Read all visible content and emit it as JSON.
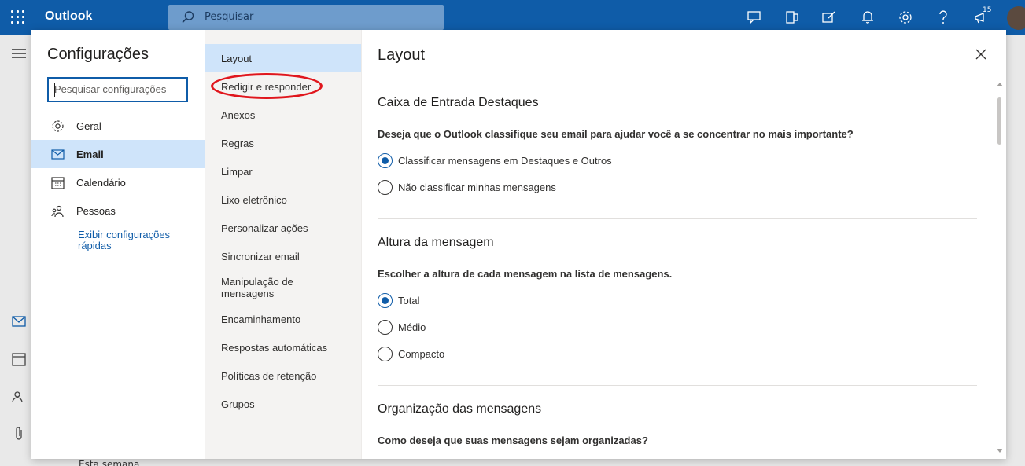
{
  "app": {
    "brand": "Outlook"
  },
  "topbar": {
    "search_placeholder": "Pesquisar",
    "notification_count": "15"
  },
  "background": {
    "week_label": "Esta semana"
  },
  "settings": {
    "title": "Configurações",
    "search_placeholder": "Pesquisar configurações",
    "categories": [
      {
        "label": "Geral",
        "icon": "gear-icon"
      },
      {
        "label": "Email",
        "icon": "mail-icon"
      },
      {
        "label": "Calendário",
        "icon": "calendar-icon"
      },
      {
        "label": "Pessoas",
        "icon": "people-icon"
      }
    ],
    "quick_settings_link": "Exibir configurações rápidas",
    "subcategories": [
      "Layout",
      "Redigir e responder",
      "Anexos",
      "Regras",
      "Limpar",
      "Lixo eletrônico",
      "Personalizar ações",
      "Sincronizar email",
      "Manipulação de mensagens",
      "Encaminhamento",
      "Respostas automáticas",
      "Políticas de retenção",
      "Grupos"
    ]
  },
  "pane": {
    "title": "Layout",
    "sections": [
      {
        "heading": "Caixa de Entrada Destaques",
        "question": "Deseja que o Outlook classifique seu email para ajudar você a se concentrar no mais importante?",
        "options": [
          "Classificar mensagens em Destaques e Outros",
          "Não classificar minhas mensagens"
        ],
        "selected": 0
      },
      {
        "heading": "Altura da mensagem",
        "question": "Escolher a altura de cada mensagem na lista de mensagens.",
        "options": [
          "Total",
          "Médio",
          "Compacto"
        ],
        "selected": 0
      },
      {
        "heading": "Organização das mensagens",
        "question": "Como deseja que suas mensagens sejam organizadas?"
      }
    ]
  },
  "colors": {
    "brand_blue": "#0f5ca8",
    "selection": "#cfe4fa",
    "annotation_red": "#e0161d"
  }
}
